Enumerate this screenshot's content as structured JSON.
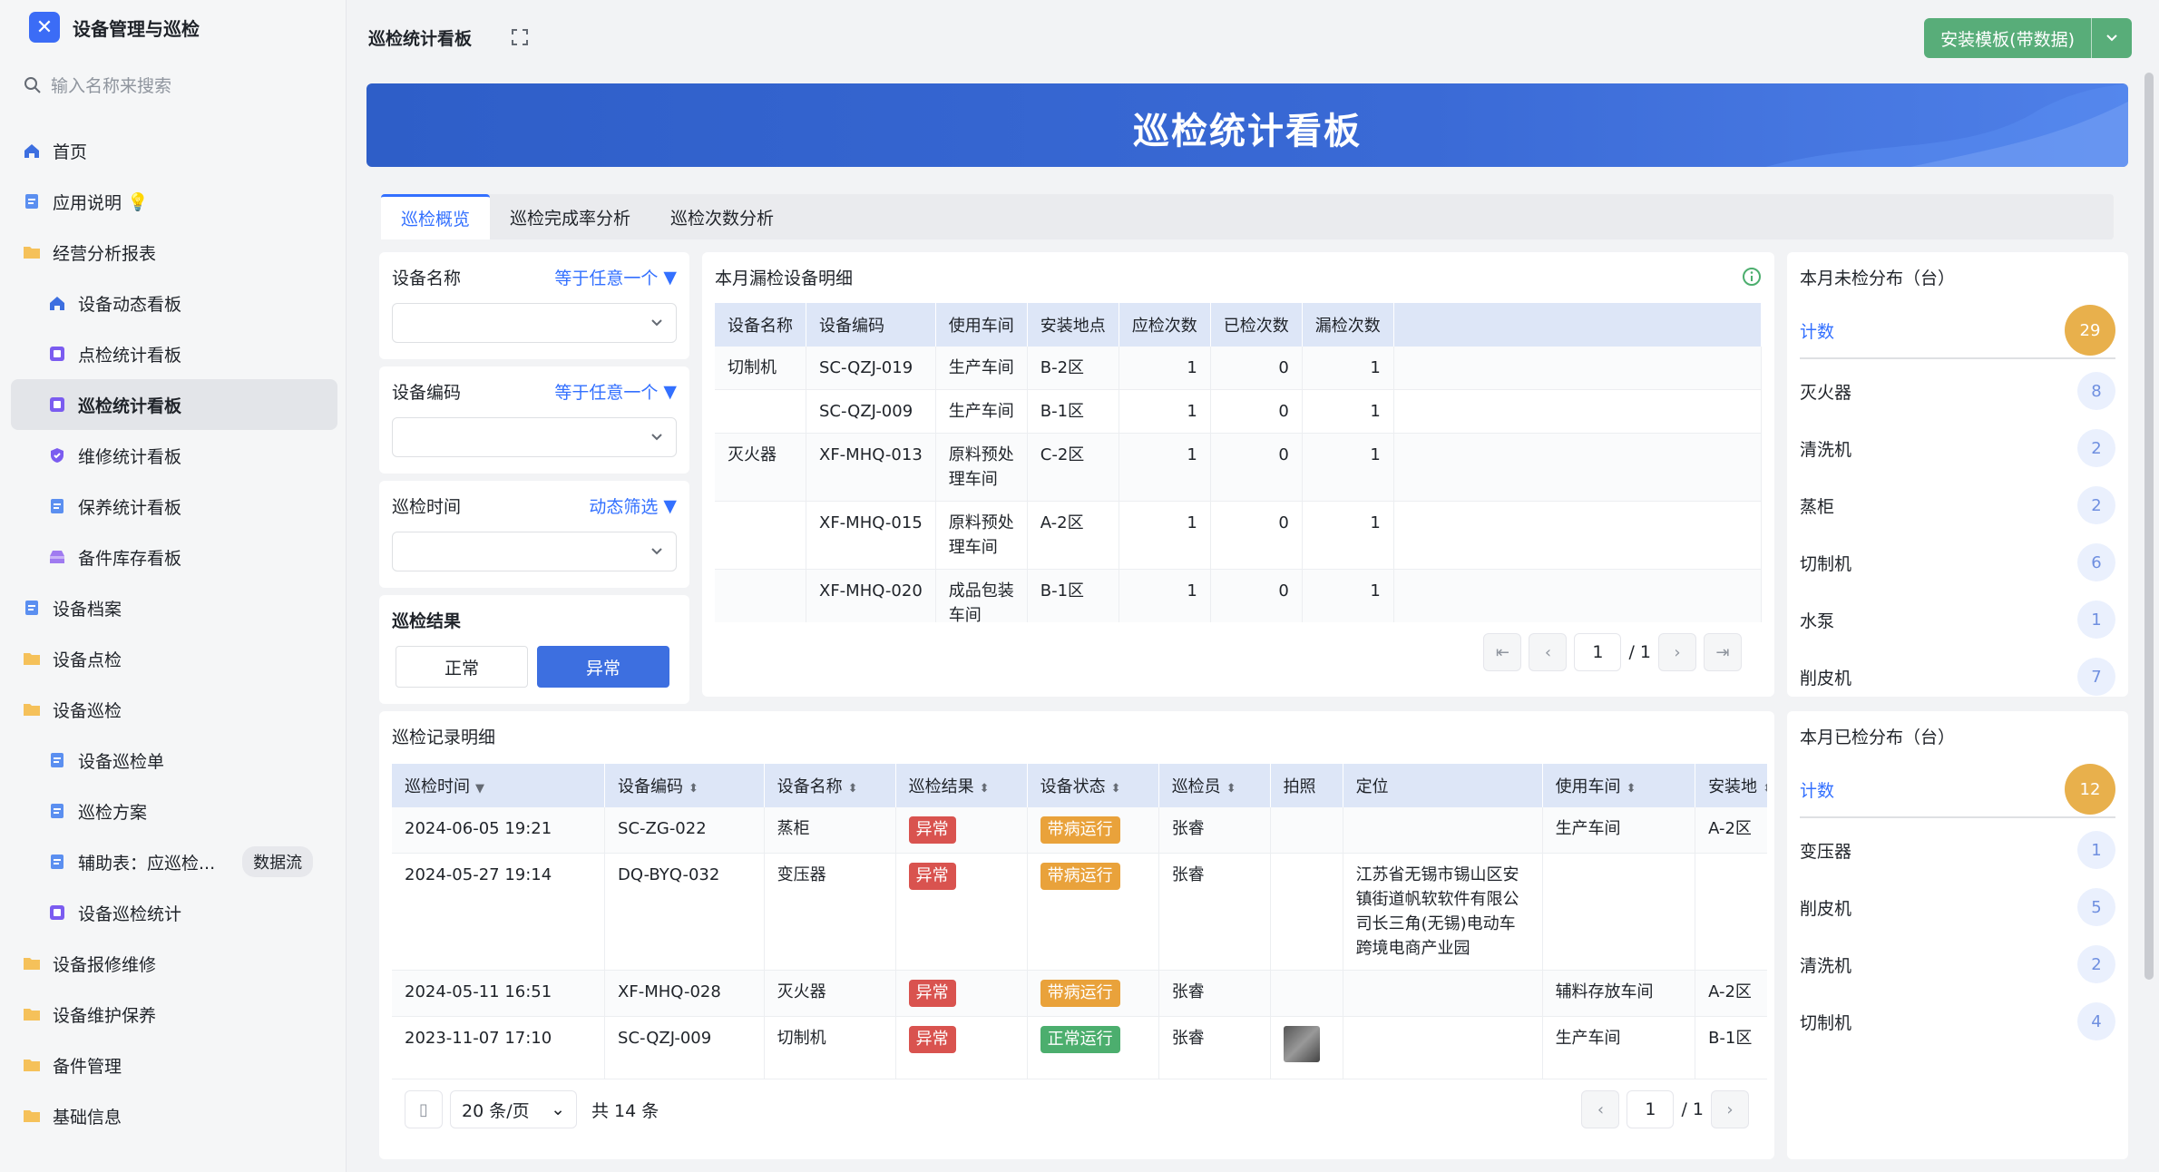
{
  "app": {
    "title": "设备管理与巡检",
    "search_placeholder": "输入名称来搜索"
  },
  "nav": [
    {
      "label": "首页",
      "icon": "home-icon",
      "level": 1
    },
    {
      "label": "应用说明",
      "icon": "doc-icon",
      "level": 1,
      "suffix": "💡"
    },
    {
      "label": "经营分析报表",
      "icon": "folder-icon",
      "level": 1
    },
    {
      "label": "设备动态看板",
      "icon": "home-icon",
      "level": 2
    },
    {
      "label": "点检统计看板",
      "icon": "dashboard-icon",
      "level": 2
    },
    {
      "label": "巡检统计看板",
      "icon": "dashboard-icon",
      "level": 2,
      "active": true
    },
    {
      "label": "维修统计看板",
      "icon": "shield-icon",
      "level": 2
    },
    {
      "label": "保养统计看板",
      "icon": "doc-icon",
      "level": 2
    },
    {
      "label": "备件库存看板",
      "icon": "inbox-icon",
      "level": 2
    },
    {
      "label": "设备档案",
      "icon": "doc-icon",
      "level": 1
    },
    {
      "label": "设备点检",
      "icon": "folder-icon",
      "level": 1
    },
    {
      "label": "设备巡检",
      "icon": "folder-icon",
      "level": 1
    },
    {
      "label": "设备巡检单",
      "icon": "doc-icon",
      "level": 2
    },
    {
      "label": "巡检方案",
      "icon": "doc-icon",
      "level": 2
    },
    {
      "label": "辅助表：应巡检...",
      "icon": "doc-icon",
      "level": 2,
      "badge": "数据流"
    },
    {
      "label": "设备巡检统计",
      "icon": "dashboard-icon",
      "level": 2
    },
    {
      "label": "设备报修维修",
      "icon": "folder-icon",
      "level": 1
    },
    {
      "label": "设备维护保养",
      "icon": "folder-icon",
      "level": 1
    },
    {
      "label": "备件管理",
      "icon": "folder-icon",
      "level": 1
    },
    {
      "label": "基础信息",
      "icon": "folder-icon",
      "level": 1
    }
  ],
  "topbar": {
    "title": "巡检统计看板",
    "install_label": "安装模板(带数据)"
  },
  "banner": {
    "title": "巡检统计看板"
  },
  "tabs": [
    "巡检概览",
    "巡检完成率分析",
    "巡检次数分析"
  ],
  "filters": {
    "device_name": {
      "label": "设备名称",
      "op": "等于任意一个"
    },
    "device_code": {
      "label": "设备编码",
      "op": "等于任意一个"
    },
    "time": {
      "label": "巡检时间",
      "op": "动态筛选"
    },
    "result": {
      "label": "巡检结果",
      "options": [
        "正常",
        "异常"
      ],
      "selected": "异常"
    }
  },
  "missed": {
    "title": "本月漏检设备明细",
    "columns": [
      "设备名称",
      "设备编码",
      "使用车间",
      "安装地点",
      "应检次数",
      "已检次数",
      "漏检次数"
    ],
    "rows": [
      {
        "name": "切制机",
        "code": "SC-QZJ-019",
        "workshop": "生产车间",
        "place": "B-2区",
        "due": "1",
        "done": "0",
        "missed": "1"
      },
      {
        "name": "",
        "code": "SC-QZJ-009",
        "workshop": "生产车间",
        "place": "B-1区",
        "due": "1",
        "done": "0",
        "missed": "1"
      },
      {
        "name": "灭火器",
        "code": "XF-MHQ-013",
        "workshop": "原料预处理车间",
        "place": "C-2区",
        "due": "1",
        "done": "0",
        "missed": "1"
      },
      {
        "name": "",
        "code": "XF-MHQ-015",
        "workshop": "原料预处理车间",
        "place": "A-2区",
        "due": "1",
        "done": "0",
        "missed": "1"
      },
      {
        "name": "",
        "code": "XF-MHQ-020",
        "workshop": "成品包装车间",
        "place": "B-1区",
        "due": "1",
        "done": "0",
        "missed": "1"
      }
    ],
    "page": "1",
    "total_pages": "/ 1"
  },
  "records": {
    "title": "巡检记录明细",
    "columns": [
      "巡检时间",
      "设备编码",
      "设备名称",
      "巡检结果",
      "设备状态",
      "巡检员",
      "拍照",
      "定位",
      "使用车间",
      "安装地"
    ],
    "rows": [
      {
        "time": "2024-06-05 19:21",
        "code": "SC-ZG-022",
        "name": "蒸柜",
        "result": "异常",
        "status": "带病运行",
        "status_color": "orange",
        "inspector": "张睿",
        "photo": false,
        "location": "",
        "workshop": "生产车间",
        "place": "A-2区"
      },
      {
        "time": "2024-05-27 19:14",
        "code": "DQ-BYQ-032",
        "name": "变压器",
        "result": "异常",
        "status": "带病运行",
        "status_color": "orange",
        "inspector": "张睿",
        "photo": false,
        "location": "江苏省无锡市锡山区安镇街道帆软软件有限公司长三角(无锡)电动车跨境电商产业园",
        "workshop": "",
        "place": ""
      },
      {
        "time": "2024-05-11 16:51",
        "code": "XF-MHQ-028",
        "name": "灭火器",
        "result": "异常",
        "status": "带病运行",
        "status_color": "orange",
        "inspector": "张睿",
        "photo": false,
        "location": "",
        "workshop": "辅料存放车间",
        "place": "A-2区"
      },
      {
        "time": "2023-11-07 17:10",
        "code": "SC-QZJ-009",
        "name": "切制机",
        "result": "异常",
        "status": "正常运行",
        "status_color": "green",
        "inspector": "张睿",
        "photo": true,
        "location": "",
        "workshop": "生产车间",
        "place": "B-1区"
      }
    ],
    "page_size": "20 条/页",
    "total": "共 14 条",
    "page": "1",
    "total_pages": "/ 1"
  },
  "unchecked": {
    "title": "本月未检分布（台）",
    "head": {
      "label": "计数",
      "value": "29"
    },
    "items": [
      {
        "label": "灭火器",
        "value": "8"
      },
      {
        "label": "清洗机",
        "value": "2"
      },
      {
        "label": "蒸柜",
        "value": "2"
      },
      {
        "label": "切制机",
        "value": "6"
      },
      {
        "label": "水泵",
        "value": "1"
      },
      {
        "label": "削皮机",
        "value": "7"
      }
    ]
  },
  "checked": {
    "title": "本月已检分布（台）",
    "head": {
      "label": "计数",
      "value": "12"
    },
    "items": [
      {
        "label": "变压器",
        "value": "1"
      },
      {
        "label": "削皮机",
        "value": "5"
      },
      {
        "label": "清洗机",
        "value": "2"
      },
      {
        "label": "切制机",
        "value": "4"
      }
    ]
  },
  "colors": {
    "accent": "#3370ff",
    "banner": "#3a6ad6",
    "install": "#58ad79",
    "danger": "#d9534f",
    "warning": "#e9a23b",
    "success": "#4cae6e"
  }
}
